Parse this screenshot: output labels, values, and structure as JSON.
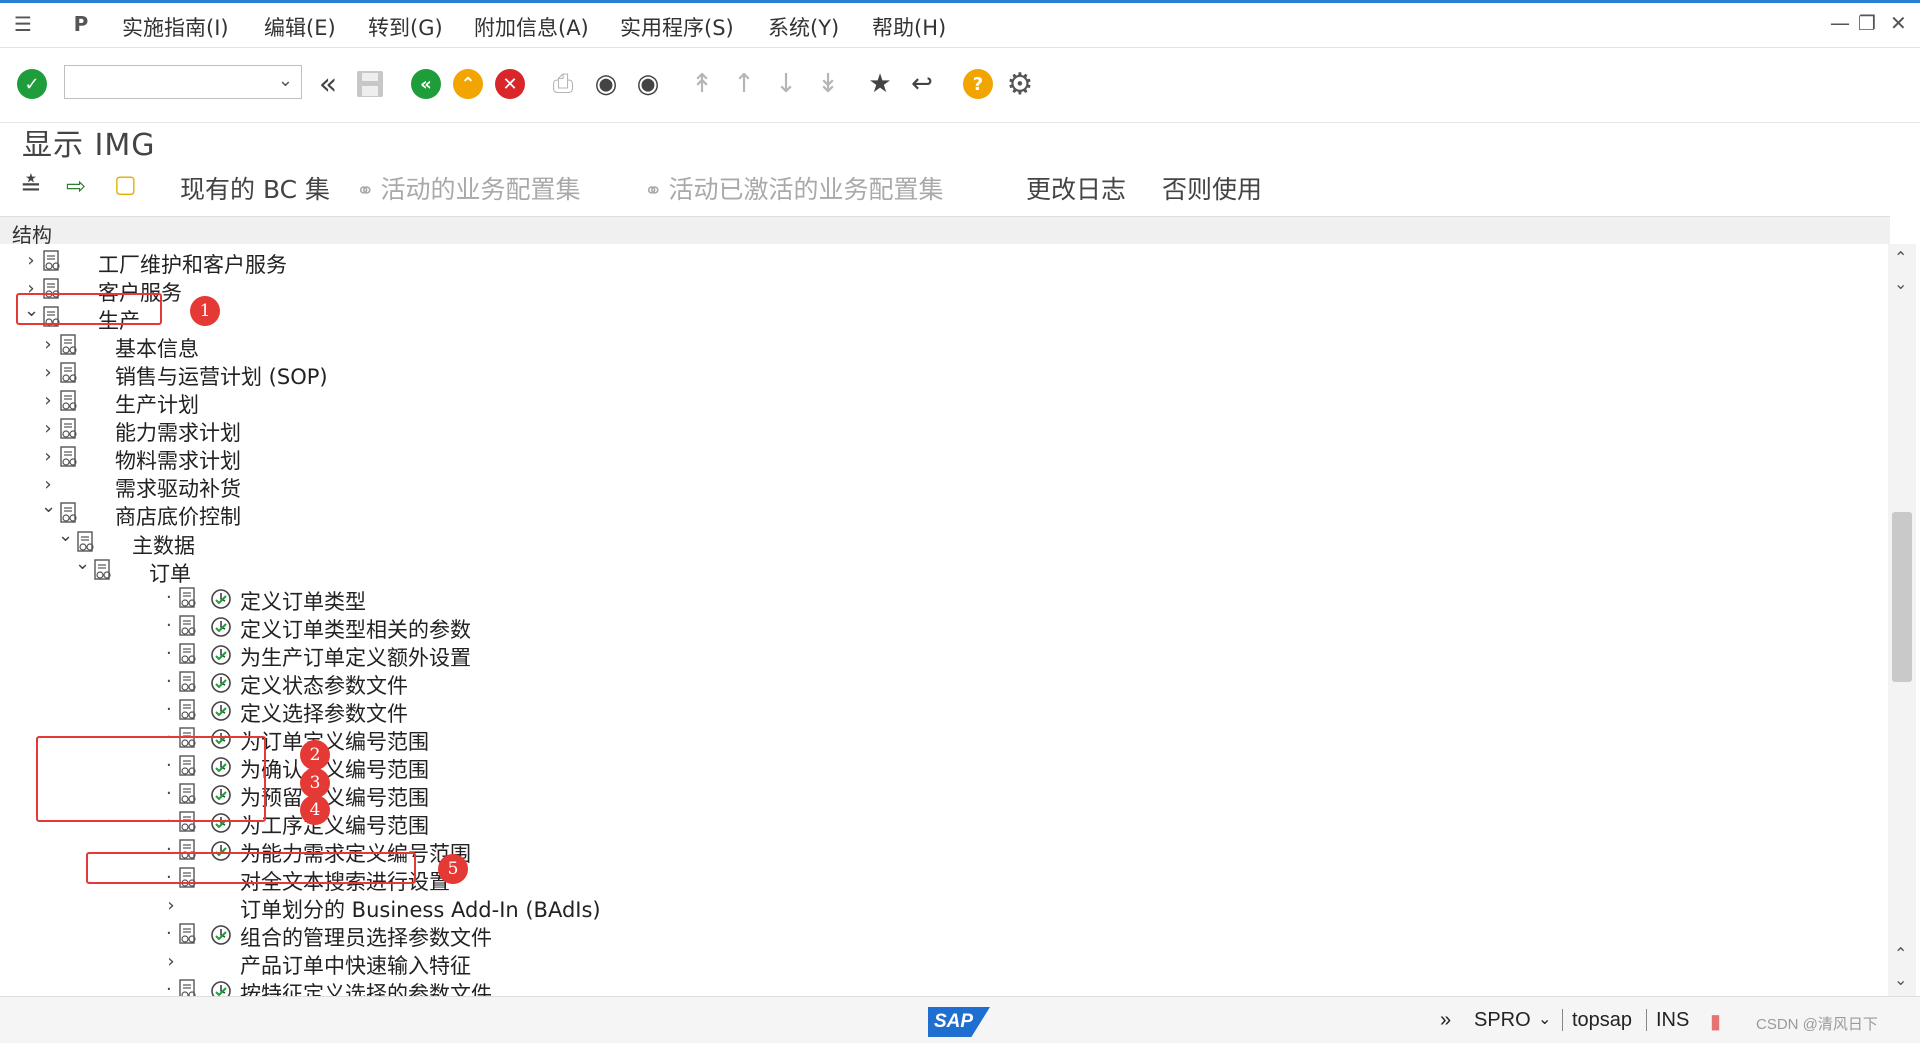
{
  "menubar": {
    "items": [
      "实施指南(I)",
      "编辑(E)",
      "转到(G)",
      "附加信息(A)",
      "实用程序(S)",
      "系统(Y)",
      "帮助(H)"
    ]
  },
  "toolbar": {
    "command_field_value": ""
  },
  "title": "显示 IMG",
  "app_toolbar": {
    "bc_sets": "现有的 BC 集",
    "active_bc": "活动的业务配置集",
    "activated_bc": "活动已激活的业务配置集",
    "change_log": "更改日志",
    "otherwise_use": "否则使用"
  },
  "structure_header": "结构",
  "tree": [
    {
      "label": "工厂维护和客户服务"
    },
    {
      "label": "客户服务"
    },
    {
      "label": "生产"
    },
    {
      "label": "基本信息"
    },
    {
      "label": "销售与运营计划 (SOP)"
    },
    {
      "label": "生产计划"
    },
    {
      "label": "能力需求计划"
    },
    {
      "label": "物料需求计划"
    },
    {
      "label": "需求驱动补货"
    },
    {
      "label": "商店底价控制"
    },
    {
      "label": "主数据"
    },
    {
      "label": "订单"
    },
    {
      "label": "定义订单类型"
    },
    {
      "label": "定义订单类型相关的参数"
    },
    {
      "label": "为生产订单定义额外设置"
    },
    {
      "label": "定义状态参数文件"
    },
    {
      "label": "定义选择参数文件"
    },
    {
      "label": "为订单定义编号范围"
    },
    {
      "label": "为确认定义编号范围"
    },
    {
      "label": "为预留定义编号范围"
    },
    {
      "label": "为工序定义编号范围"
    },
    {
      "label": "为能力需求定义编号范围"
    },
    {
      "label": "对全文本搜索进行设置"
    },
    {
      "label": "订单划分的 Business Add-In (BAdIs)"
    },
    {
      "label": "组合的管理员选择参数文件"
    },
    {
      "label": "产品订单中快速输入特征"
    },
    {
      "label": "按特征定义选择的参数文件"
    }
  ],
  "annotations": [
    "1",
    "2",
    "3",
    "4",
    "5"
  ],
  "statusbar": {
    "logo": "SAP",
    "expand": "»",
    "transaction": "SPRO",
    "system": "topsap",
    "mode": "INS",
    "watermark": "CSDN @清风日下"
  },
  "colors": {
    "accent_blue": "#2a7fd4",
    "ok_green": "#1f9d3a",
    "nav_green": "#1f9d3a",
    "nav_orange": "#f2a400",
    "cancel_red": "#d9262b",
    "help_yellow": "#f2a400",
    "highlight_red": "#e53935"
  },
  "icons": {
    "system_menu": "hamburger-icon",
    "enter": "check-icon",
    "back": "back-icon",
    "exit": "up-icon",
    "cancel": "cancel-icon",
    "help": "help-icon",
    "settings": "gear-icon"
  }
}
